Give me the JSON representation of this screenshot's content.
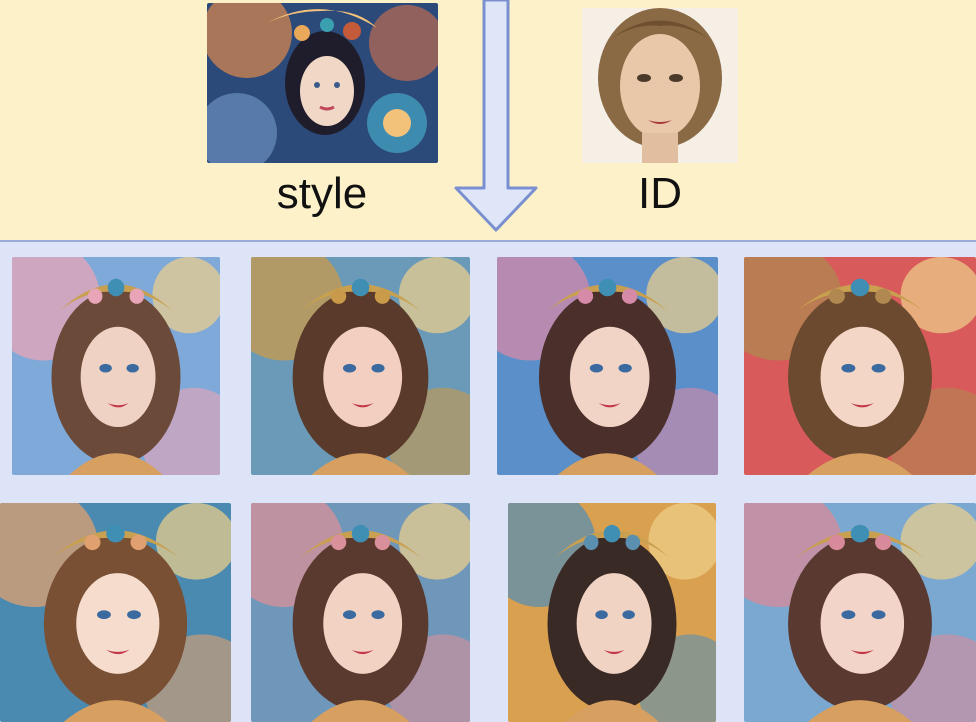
{
  "labels": {
    "style": "style",
    "id": "ID"
  },
  "images": {
    "style_reference": {
      "icon": "stylized-ornate-portrait",
      "palette": [
        "#2b4a7a",
        "#e0894b",
        "#f4c27a",
        "#3a2b40"
      ]
    },
    "id_reference": {
      "icon": "face-photo",
      "palette": [
        "#8a6a45",
        "#e8c8a8",
        "#f5efe6",
        "#5a3d25"
      ]
    },
    "generated": [
      {
        "row": 1,
        "col": 1,
        "palette": [
          "#e8a5b8",
          "#6b4a3a",
          "#f0d2c4",
          "#7fa9d8"
        ]
      },
      {
        "row": 1,
        "col": 2,
        "palette": [
          "#c99a4a",
          "#5a3a2a",
          "#f2cfc0",
          "#6a9ab8"
        ]
      },
      {
        "row": 1,
        "col": 3,
        "palette": [
          "#d58aa8",
          "#4a2f2a",
          "#f1d4c6",
          "#5b8fc9"
        ]
      },
      {
        "row": 1,
        "col": 4,
        "palette": [
          "#b08850",
          "#6b4a30",
          "#f3d6c5",
          "#d85a5a"
        ]
      },
      {
        "row": 2,
        "col": 1,
        "palette": [
          "#e0a070",
          "#7a5035",
          "#f5dccd",
          "#4a8ab0"
        ]
      },
      {
        "row": 2,
        "col": 2,
        "palette": [
          "#d9909a",
          "#5a3a2e",
          "#f2d2c2",
          "#6f97b9"
        ]
      },
      {
        "row": 2,
        "col": 3,
        "palette": [
          "#5a8fb0",
          "#3a2a25",
          "#f1d3c4",
          "#d9a050"
        ]
      },
      {
        "row": 2,
        "col": 4,
        "palette": [
          "#d98a9a",
          "#5a3a30",
          "#f2d5c8",
          "#7aa8d0"
        ]
      }
    ]
  },
  "colors": {
    "top_background": "#fcf1c8",
    "bottom_background": "#dde4f7",
    "divider": "#9aaad8",
    "arrow_fill": "#dfe6f8",
    "arrow_stroke": "#7a8fd0"
  }
}
